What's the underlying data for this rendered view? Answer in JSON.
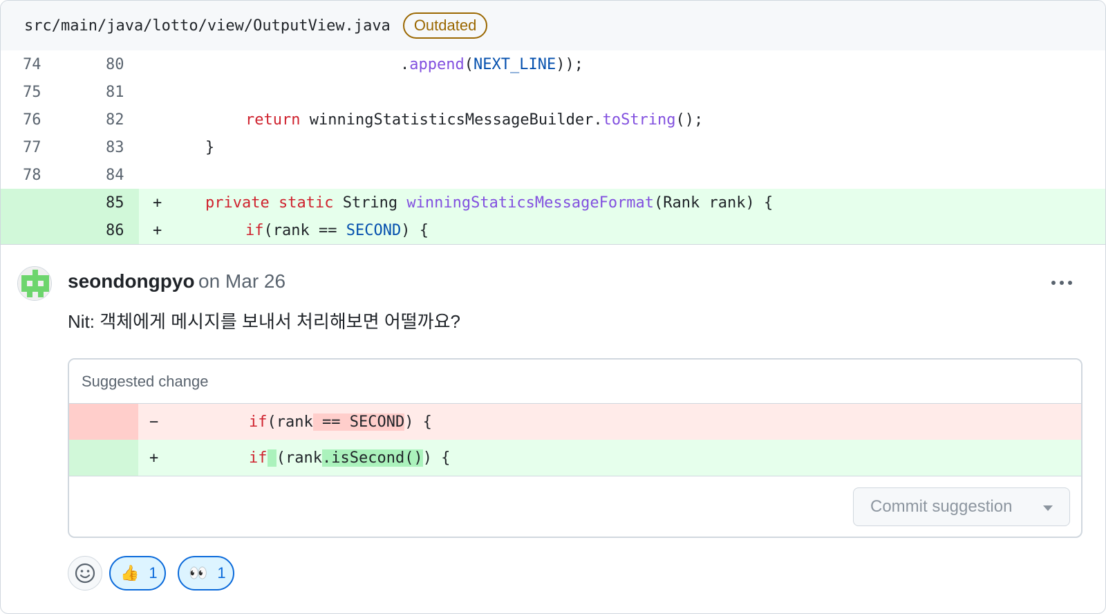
{
  "file": {
    "path": "src/main/java/lotto/view/OutputView.java",
    "badge": "Outdated"
  },
  "diff": {
    "rows": [
      {
        "old": "74",
        "new": "80",
        "marker": "",
        "type": "context"
      },
      {
        "old": "75",
        "new": "81",
        "marker": "",
        "type": "context"
      },
      {
        "old": "76",
        "new": "82",
        "marker": "",
        "type": "context"
      },
      {
        "old": "77",
        "new": "83",
        "marker": "",
        "type": "context"
      },
      {
        "old": "78",
        "new": "84",
        "marker": "",
        "type": "context"
      },
      {
        "old": "",
        "new": "85",
        "marker": "+",
        "type": "added"
      },
      {
        "old": "",
        "new": "86",
        "marker": "+",
        "type": "added"
      }
    ],
    "code": {
      "r0_dot": ".",
      "r0_append": "append",
      "r0_open": "(",
      "r0_const": "NEXT_LINE",
      "r0_close": "));",
      "r2_return": "return",
      "r2_rest": " winningStatisticsMessageBuilder.",
      "r2_fn": "toString",
      "r2_end": "();",
      "r3_brace": "}",
      "r5_private": "private",
      "r5_static": "static",
      "r5_type": " String ",
      "r5_fn": "winningStaticsMessageFormat",
      "r5_params": "(Rank rank) {",
      "r6_if": "if",
      "r6_mid": "(rank == ",
      "r6_const": "SECOND",
      "r6_end": ") {"
    }
  },
  "comment": {
    "author": "seondongpyo",
    "date": "on Mar 26",
    "body": "Nit: 객체에게 메시지를 보내서 처리해보면 어떨까요?",
    "avatar_icon": "identicon-avatar",
    "menu_icon": "kebab-horizontal-icon"
  },
  "suggestion": {
    "header": "Suggested change",
    "del_marker": "−",
    "add_marker": "+",
    "del": {
      "kw": "if",
      "a": "(rank",
      "hl": " == SECOND",
      "b": ") {"
    },
    "add": {
      "kw": "if",
      "hl1": " ",
      "a": "(rank",
      "hl2": ".isSecond()",
      "b": ") {"
    },
    "commit_label": "Commit suggestion"
  },
  "reactions": [
    {
      "icon": "thumbs-up-icon",
      "emoji": "👍",
      "count": "1"
    },
    {
      "icon": "eyes-icon",
      "emoji": "👀",
      "count": "1"
    }
  ],
  "colors": {
    "added_bg": "#e6ffec",
    "deleted_bg": "#ffebe9",
    "keyword": "#cf222e",
    "function": "#8250df",
    "constant": "#0550ae",
    "badge": "#9a6700",
    "reaction_accent": "#0969da"
  }
}
